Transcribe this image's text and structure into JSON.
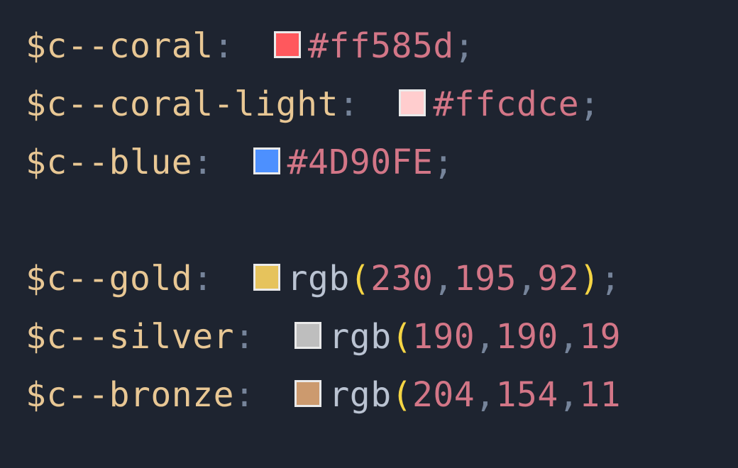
{
  "lines": [
    {
      "var": "$c--coral",
      "type": "hex",
      "hex": "#ff585d",
      "swatch": "#ff585d"
    },
    {
      "var": "$c--coral-light",
      "type": "hex",
      "hex": "#ffcdce",
      "swatch": "#ffcdce"
    },
    {
      "var": "$c--blue",
      "type": "hex",
      "hex": "#4D90FE",
      "swatch": "#4D90FE"
    },
    {
      "blank": true
    },
    {
      "var": "$c--gold",
      "type": "rgb",
      "func": "rgb",
      "args": [
        "230",
        "195",
        "92"
      ],
      "swatch": "rgb(230,195,92)",
      "trailSemi": true
    },
    {
      "var": "$c--silver",
      "type": "rgb",
      "func": "rgb",
      "args": [
        "190",
        "190",
        "19"
      ],
      "swatch": "rgb(190,190,190)",
      "open": true
    },
    {
      "var": "$c--bronze",
      "type": "rgb",
      "func": "rgb",
      "args": [
        "204",
        "154",
        "11"
      ],
      "swatch": "rgb(204,154,110)",
      "open": true
    }
  ],
  "punct": {
    "colon": ":",
    "semi": ";",
    "comma": ",",
    "lparen": "(",
    "rparen": ")"
  }
}
